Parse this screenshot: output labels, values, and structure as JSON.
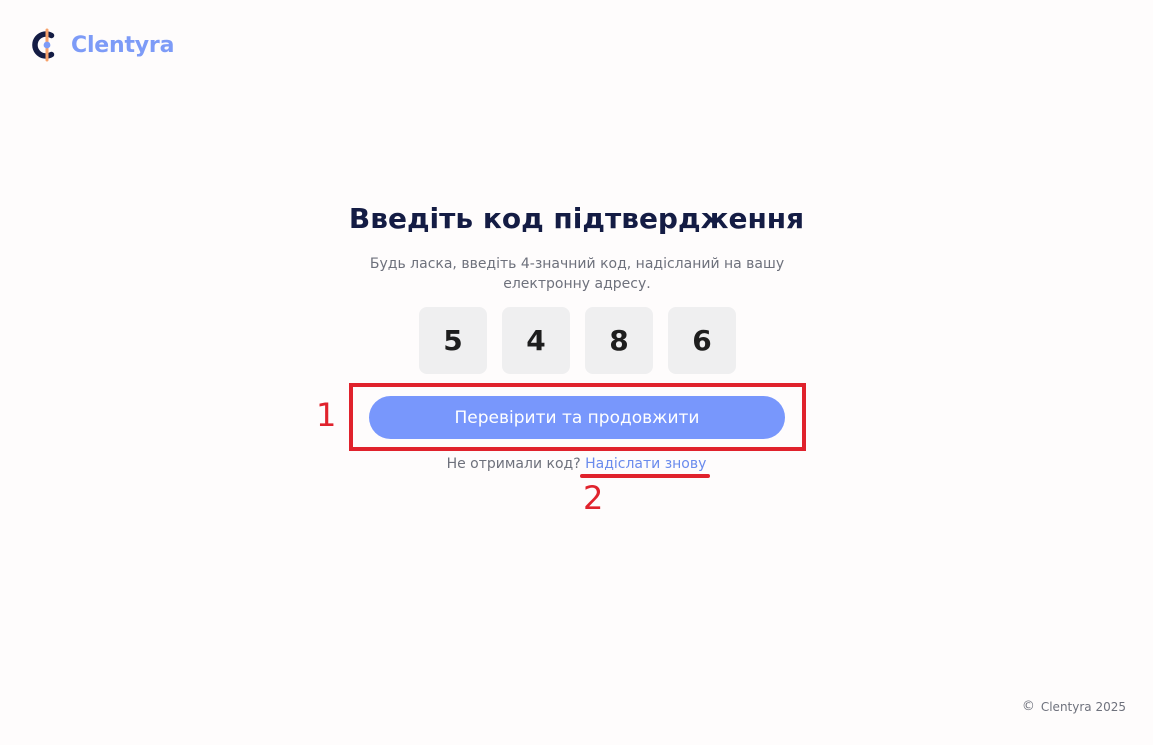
{
  "brand": {
    "name": "Clentyra",
    "accent": "#7d9bf7",
    "logo_icon": "clentyra-logo-icon"
  },
  "main": {
    "title": "Введіть код підтвердження",
    "subtitle": "Будь ласка, введіть 4-значний код, надісланий на вашу електронну адресу.",
    "code_digits": [
      "5",
      "4",
      "8",
      "6"
    ],
    "verify_button_label": "Перевірити та продовжити",
    "verify_button_color": "#7897fc",
    "resend_prompt": "Не отримали код?",
    "resend_link_label": "Надіслати знову"
  },
  "annotations": {
    "marker_1": "1",
    "marker_2": "2",
    "color": "#e0222c"
  },
  "footer": {
    "copyright_symbol": "©",
    "text": "Clentyra 2025"
  }
}
